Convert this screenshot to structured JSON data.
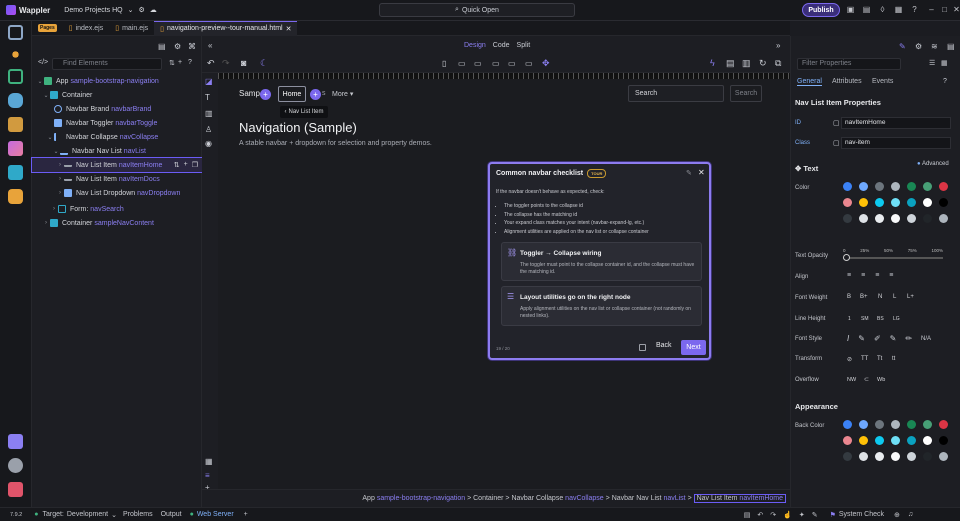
{
  "app": {
    "name": "Wappler",
    "project": "Demo Projects HQ",
    "quick_open": "Quick Open",
    "publish": "Publish"
  },
  "tabs": {
    "pages_badge": "Pages",
    "items": [
      {
        "label": "index.ejs"
      },
      {
        "label": "main.ejs"
      },
      {
        "label": "navigation-preview--tour-manual.html"
      }
    ]
  },
  "leftpanel": {
    "filter_placeholder": "Find Elements",
    "tree": [
      {
        "label": "App",
        "id": "sample-bootstrap-navigation",
        "color": "#3fb27f"
      },
      {
        "label": "Container",
        "id": "",
        "color": "#2fa9c9"
      },
      {
        "label": "Navbar Brand",
        "id": "navbarBrand",
        "color": "#7fb0f7"
      },
      {
        "label": "Navbar Toggler",
        "id": "navbarToggle",
        "color": "#7fb0f7"
      },
      {
        "label": "Navbar Collapse",
        "id": "navCollapse",
        "color": "#7fb0f7"
      },
      {
        "label": "Navbar Nav List",
        "id": "navList",
        "color": "#7fb0f7"
      },
      {
        "label": "Nav List Item",
        "id": "navItemHome",
        "color": "#9aa0aa"
      },
      {
        "label": "Nav List Item",
        "id": "navItemDocs",
        "color": "#9aa0aa"
      },
      {
        "label": "Nav List Dropdown",
        "id": "navDropdown",
        "color": "#7fb0f7"
      },
      {
        "label": "Form:",
        "id": "navSearch",
        "color": "#2fa9c9"
      },
      {
        "label": "Container",
        "id": "sampleNavContent",
        "color": "#2fa9c9"
      }
    ]
  },
  "canvas": {
    "modes": [
      "Design",
      "Code",
      "Split"
    ],
    "active_mode": "Design"
  },
  "preview": {
    "brand": "Samp",
    "home": "Home",
    "docs": "s",
    "more": "More ▾",
    "search_placeholder": "Search",
    "search_button": "Search",
    "tooltip": "Nav List Item",
    "title": "Navigation (Sample)",
    "subtitle": "A stable navbar + dropdown for selection and property demos."
  },
  "tour": {
    "title": "Common navbar checklist",
    "badge": "TOUR",
    "intro": "If the navbar doesn't behave as expected, check:",
    "bullets": [
      "The toggler points to the collapse id",
      "The collapse has the matching id",
      "Your expand class matches your intent (navbar-expand-lg, etc.)",
      "Alignment utilities are applied on the nav list or collapse container"
    ],
    "cards": [
      {
        "title": "Toggler → Collapse wiring",
        "body": "The toggler must point to the collapse container id, and the collapse must have the matching id."
      },
      {
        "title": "Layout utilities go on the right node",
        "body": "Apply alignment utilities on the nav list or collapse container (not randomly on nested links)."
      }
    ],
    "step": "19 / 20",
    "back": "Back",
    "next": "Next"
  },
  "breadcrumb": [
    {
      "label": "App",
      "id": "sample-bootstrap-navigation"
    },
    {
      "label": "Container",
      "id": ""
    },
    {
      "label": "Navbar Collapse",
      "id": "navCollapse"
    },
    {
      "label": "Navbar Nav List",
      "id": "navList"
    },
    {
      "label": "Nav List Item",
      "id": "navItemHome"
    }
  ],
  "rightpanel": {
    "filter_placeholder": "Filter Properties",
    "tabs": [
      "General",
      "Attributes",
      "Events"
    ],
    "section_title": "Nav List Item Properties",
    "id_label": "ID",
    "id_value": "navItemHome",
    "class_label": "Class",
    "class_value": "nav-item",
    "text_section": "Text",
    "advanced": "Advanced",
    "color_label": "Color",
    "opacity_label": "Text Opacity",
    "opacity_ticks": [
      "0",
      "25%",
      "50%",
      "75%",
      "100%"
    ],
    "align_label": "Align",
    "weight_label": "Font Weight",
    "weights": [
      "B",
      "B+",
      "N",
      "L",
      "L+"
    ],
    "lineheight_label": "Line Height",
    "lineheights": [
      "1",
      "SM",
      "BS",
      "LG"
    ],
    "fontstyle_label": "Font Style",
    "fontstyle_na": "N/A",
    "transform_label": "Transform",
    "transforms": [
      "TT",
      "Tt",
      "tt"
    ],
    "overflow_label": "Overflow",
    "overflows": [
      "NW",
      "",
      "Wb"
    ],
    "appearance_section": "Appearance",
    "backcolor_label": "Back Color"
  },
  "status": {
    "zoom": "7.9.2",
    "target_label": "Target:",
    "target": "Development",
    "problems": "Problems",
    "output": "Output",
    "webserver": "Web Server",
    "system_check": "System Check"
  },
  "colors": {
    "accent": "#7b68ee",
    "text_swatches": [
      "#3b82f6",
      "#6ea8fe",
      "#6c757d",
      "#adb5bd",
      "#198754",
      "#479f76",
      "#dc3545",
      "#ea868f",
      "#ffc107",
      "#0dcaf0",
      "#6edff6",
      "#0aa2c0",
      "#ffffff",
      "#000000",
      "#343a40",
      "#dee2e6",
      "#e9ecef",
      "#f8f9fa",
      "#ced4da",
      "#212529"
    ]
  }
}
